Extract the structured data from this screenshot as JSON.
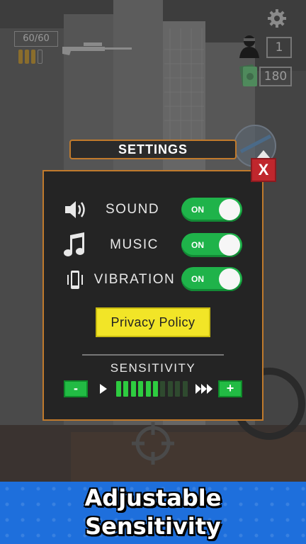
{
  "hud": {
    "ammo": "60/60",
    "ammo_clips_total": 4,
    "ammo_clips_loaded": 3,
    "kills": "1",
    "cash": "180",
    "icons": {
      "settings": "gear-icon",
      "ammo": "ammo-icon",
      "weapon": "sniper-rifle-icon",
      "kills": "enemy-silhouette-icon",
      "cash": "cash-icon",
      "switch_weapon": "weapon-upgrade-icon",
      "aim": "crosshair-icon"
    }
  },
  "settings": {
    "title": "SETTINGS",
    "close_label": "X",
    "rows": [
      {
        "label": "SOUND",
        "state": "ON",
        "icon": "speaker-icon"
      },
      {
        "label": "MUSIC",
        "state": "ON",
        "icon": "music-note-icon"
      },
      {
        "label": "VIBRATION",
        "state": "ON",
        "icon": "vibration-icon"
      }
    ],
    "privacy_label": "Privacy Policy",
    "sensitivity": {
      "label": "SENSITIVITY",
      "decrease_label": "-",
      "increase_label": "+",
      "level": 6,
      "max": 10,
      "slow_icon": "play-icon",
      "fast_icon": "fast-forward-icon"
    }
  },
  "banner": {
    "line1": "Adjustable",
    "line2": "Sensitivity"
  },
  "colors": {
    "panel_border": "#c07a2c",
    "toggle_on": "#1fb34a",
    "close": "#c0272d",
    "privacy": "#f2e527",
    "sens_active": "#2ecc40",
    "sens_inactive": "#2f4a2f",
    "banner": "#1e6fdc"
  }
}
